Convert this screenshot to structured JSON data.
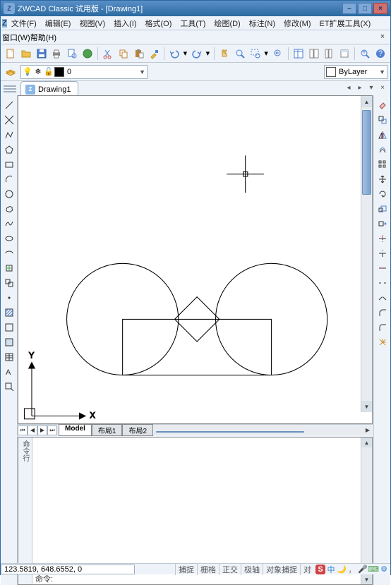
{
  "window": {
    "title": "ZWCAD Classic 试用版 - [Drawing1]",
    "minimize": "–",
    "maximize": "□",
    "close": "×"
  },
  "menu": {
    "file": "文件(F)",
    "edit": "编辑(E)",
    "view": "视图(V)",
    "insert": "插入(I)",
    "format": "格式(O)",
    "tools": "工具(T)",
    "draw": "绘图(D)",
    "dimension": "标注(N)",
    "modify": "修改(M)",
    "et": "ET扩展工具(X)",
    "window": "窗口(W)",
    "help": "帮助(H)"
  },
  "layer": {
    "current": "0",
    "bylayer": "ByLayer"
  },
  "doc": {
    "name": "Drawing1"
  },
  "sheets": {
    "model": "Model",
    "layout1": "布局1",
    "layout2": "布局2"
  },
  "cmd": {
    "prompt": "命令:"
  },
  "status": {
    "coords": "123.5819, 648.6552, 0",
    "snap": "捕捉",
    "grid": "栅格",
    "ortho": "正交",
    "polar": "极轴",
    "osnap": "对象捕捉",
    "otrack": "对"
  },
  "tray": {
    "s": "S",
    "zhong": "中"
  },
  "axis": {
    "x": "X",
    "y": "Y"
  }
}
